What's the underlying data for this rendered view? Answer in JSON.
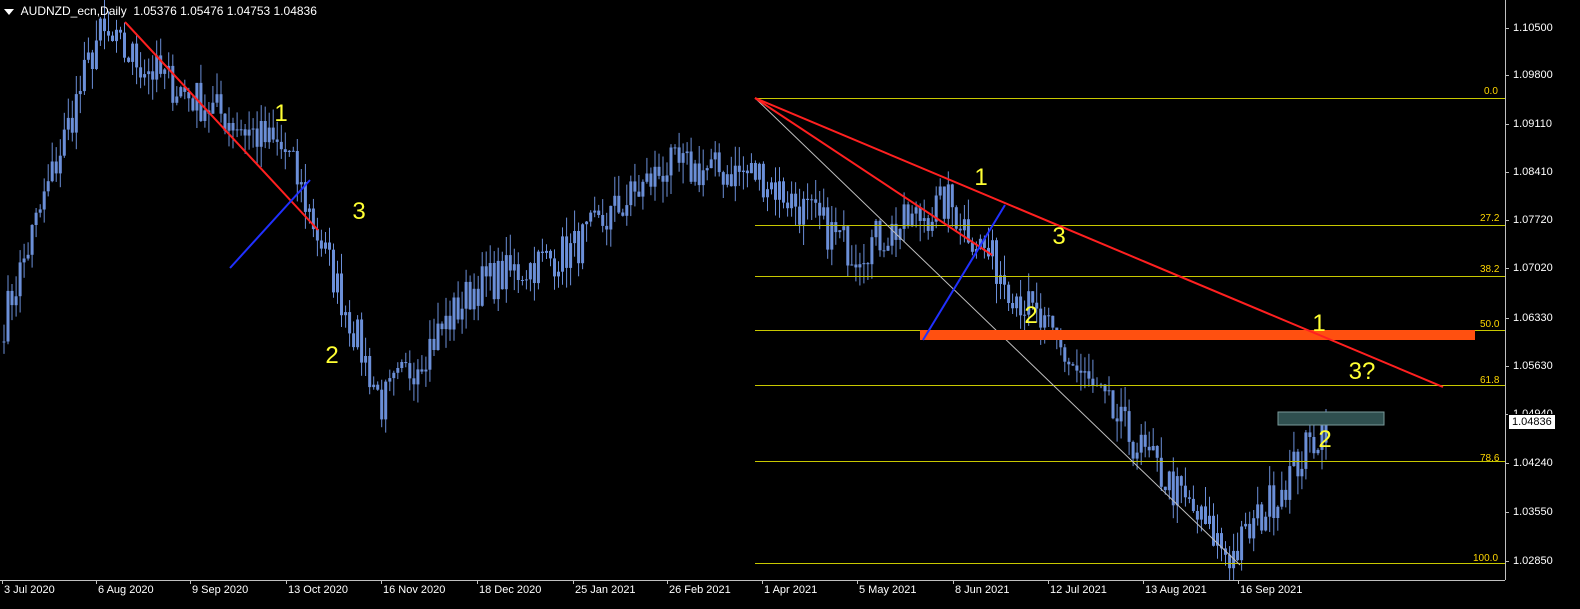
{
  "header": {
    "symbol": "AUDNZD_ecn,Daily",
    "ohlc": "1.05376 1.05476 1.04753 1.04836"
  },
  "price_axis": {
    "labels": [
      "1.10500",
      "1.09800",
      "1.09110",
      "1.08410",
      "1.07720",
      "1.07020",
      "1.06330",
      "1.05630",
      "1.04940",
      "1.04240",
      "1.03550",
      "1.02850"
    ],
    "current_price": "1.04836"
  },
  "time_axis": {
    "labels": [
      "3 Jul 2020",
      "6 Aug 2020",
      "9 Sep 2020",
      "13 Oct 2020",
      "16 Nov 2020",
      "18 Dec 2020",
      "25 Jan 2021",
      "26 Feb 2021",
      "1 Apr 2021",
      "5 May 2021",
      "8 Jun 2021",
      "12 Jul 2021",
      "13 Aug 2021",
      "16 Sep 2021"
    ]
  },
  "fibonacci": {
    "levels": [
      "0.0",
      "27.2",
      "38.2",
      "50.0",
      "61.8",
      "78.6",
      "100.0"
    ],
    "prices": [
      1.095,
      1.0767,
      1.0694,
      1.0616,
      1.0538,
      1.0428,
      1.0282
    ]
  },
  "wave_labels": {
    "w1a": "1",
    "w2a": "2",
    "w3a": "3",
    "w1b": "1",
    "w2b": "2",
    "w3b": "3",
    "w1c": "1",
    "w2c": "2",
    "w3c": "3?"
  },
  "colors": {
    "background": "#000000",
    "candles": "#6b8fd8",
    "trendline_red": "#ff2020",
    "trendline_blue": "#2030ff",
    "fib_lines": "#c8c800",
    "resistance_zone": "#ff5010",
    "target_zone": "#2f4f4f",
    "wave_labels": "#ffff33"
  },
  "chart_data": {
    "type": "candlestick",
    "symbol": "AUDNZD_ecn",
    "timeframe": "Daily",
    "x": [
      "3 Jul 2020",
      "6 Aug 2020",
      "9 Sep 2020",
      "13 Oct 2020",
      "16 Nov 2020",
      "18 Dec 2020",
      "25 Jan 2021",
      "26 Feb 2021",
      "1 Apr 2021",
      "5 May 2021",
      "8 Jun 2021",
      "12 Jul 2021",
      "13 Aug 2021",
      "16 Sep 2021",
      "1 Oct 2021"
    ],
    "close_approx": [
      1.063,
      1.104,
      1.095,
      1.087,
      1.051,
      1.068,
      1.073,
      1.085,
      1.084,
      1.073,
      1.08,
      1.062,
      1.045,
      1.029,
      1.0484
    ],
    "ylim": [
      1.026,
      1.108
    ]
  }
}
